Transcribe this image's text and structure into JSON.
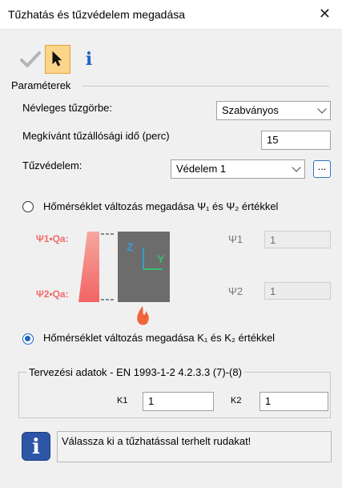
{
  "window": {
    "title": "Tűzhatás és tűzvédelem megadása",
    "close_glyph": "✕"
  },
  "toolbar": {
    "ok_icon": "checkmark-icon",
    "select_icon": "cursor-icon",
    "info_icon": "info-icon",
    "info_glyph": "i",
    "accent": "#1a66c2"
  },
  "parameters": {
    "group_label": "Paraméterek",
    "curve_label": "Névleges tűzgörbe:",
    "curve_value": "Szabványos",
    "time_label": "Megkívánt tűzállósági idő (perc)",
    "time_value": "15",
    "protection_label": "Tűzvédelem:",
    "protection_value": "Védelem 1",
    "protection_button": "..."
  },
  "option1": {
    "label": "Hőmérséklet változás megadása Ψ₁ és Ψ₂ értékkel",
    "selected": false,
    "diagram": {
      "top_label": "Ψ1•Qa:",
      "bottom_label": "Ψ2•Qa:",
      "axis_z": "Z",
      "axis_y": "Y"
    },
    "psi1_label": "Ψ1",
    "psi1_value": "1",
    "psi2_label": "Ψ2",
    "psi2_value": "1"
  },
  "option2": {
    "label": "Hőmérséklet változás megadása K₁ és K₂ értékkel",
    "selected": true
  },
  "design": {
    "legend": "Tervezési adatok - EN 1993-1-2 4.2.3.3 (7)-(8)",
    "k1_label": "K1",
    "k1_value": "1",
    "k2_label": "K2",
    "k2_value": "1"
  },
  "status": {
    "icon_glyph": "i",
    "message": "Válassza ki a tűzhatással terhelt rudakat!"
  }
}
